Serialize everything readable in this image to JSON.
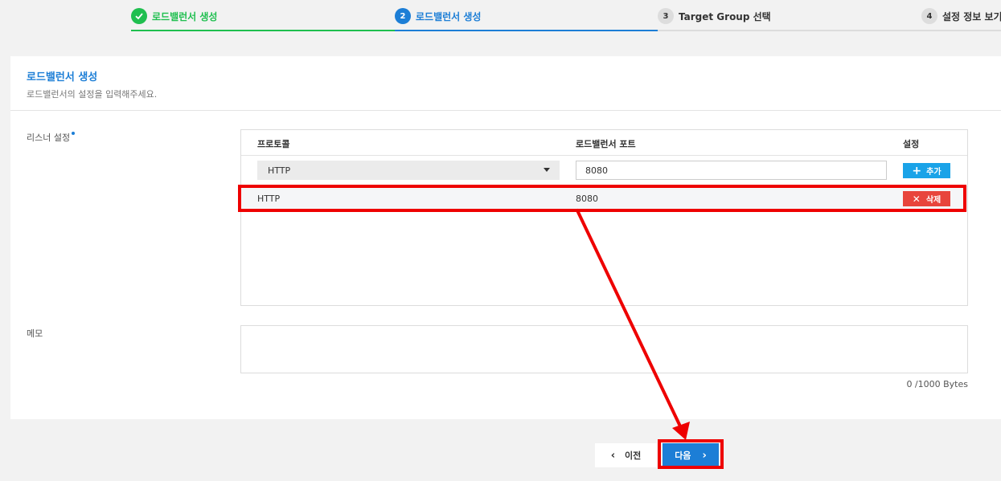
{
  "stepper": {
    "steps": [
      {
        "number": "",
        "label": "로드밸런서 생성",
        "state": "done"
      },
      {
        "number": "2",
        "label": "로드밸런서 생성",
        "state": "active"
      },
      {
        "number": "3",
        "label": "Target Group 선택",
        "state": "pending"
      },
      {
        "number": "4",
        "label": "설정 정보 보기",
        "state": "pending"
      }
    ]
  },
  "card": {
    "title": "로드밸런서 생성",
    "description": "로드밸런서의 설정을 입력해주세요."
  },
  "listener": {
    "label": "리스너 설정",
    "columns": {
      "protocol": "프로토콜",
      "port": "로드밸런서 포트",
      "setting": "설정"
    },
    "form": {
      "protocol_value": "HTTP",
      "port_value": "8080",
      "add_label": "추가"
    },
    "rows": [
      {
        "protocol": "HTTP",
        "port": "8080",
        "delete_label": "삭제"
      }
    ]
  },
  "memo": {
    "label": "메모",
    "counter": "0 /1000 Bytes"
  },
  "footer": {
    "prev_label": "이전",
    "next_label": "다음"
  },
  "colors": {
    "done": "#1fbf4f",
    "active": "#1c7ed6",
    "add_button": "#1aa3e8",
    "delete_button": "#e8453c",
    "annotation": "#ee0000"
  }
}
